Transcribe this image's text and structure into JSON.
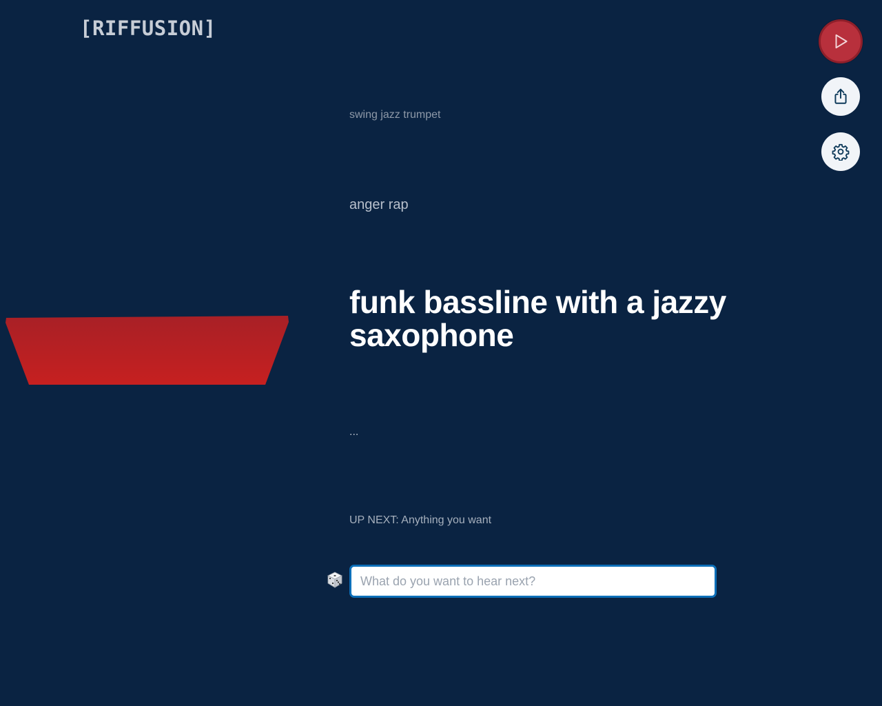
{
  "app": {
    "logo_text": "[RIFFUSION]"
  },
  "prompts": {
    "previous_2": "swing jazz trumpet",
    "previous_1": "anger rap",
    "current": "funk bassline with a jazzy saxophone",
    "next": "..."
  },
  "up_next": {
    "text": "UP NEXT: Anything you want"
  },
  "prompt_input": {
    "value": "",
    "placeholder": "What do you want to hear next?"
  },
  "controls": {
    "play_icon": "play-icon",
    "share_icon": "share-icon",
    "settings_icon": "gear-icon",
    "dice_icon": "dice-icon"
  },
  "colors": {
    "background": "#0a2342",
    "play_button": "#b8303c",
    "visual_shape": "#c02020",
    "input_border": "#0d6fb8"
  }
}
